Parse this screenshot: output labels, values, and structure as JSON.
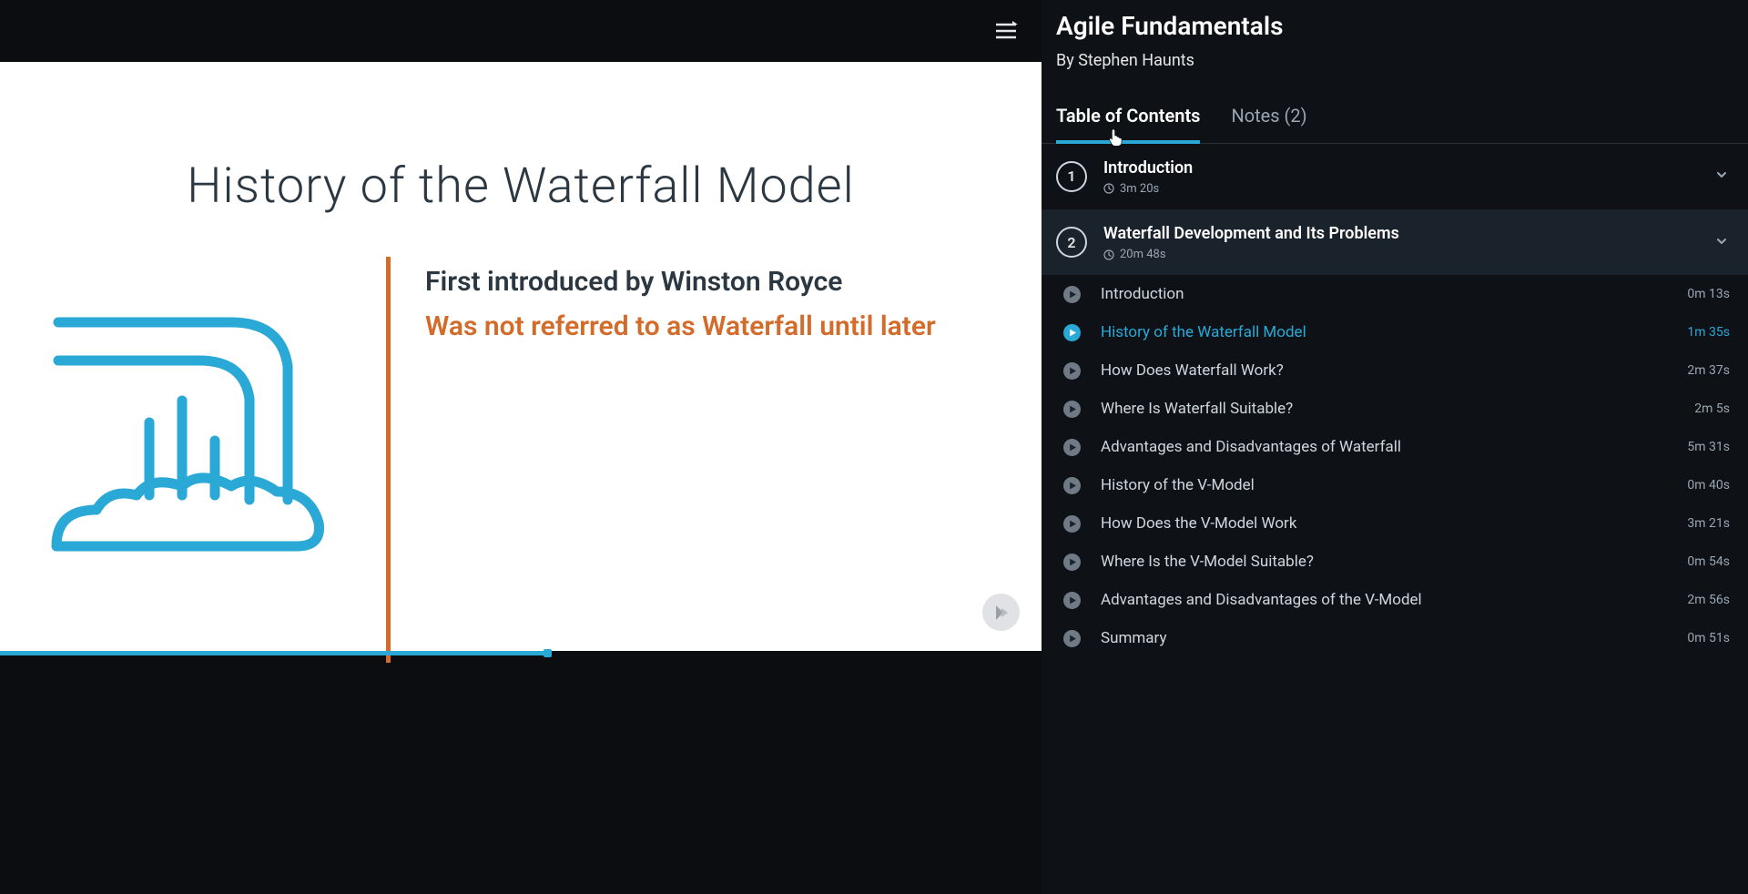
{
  "course": {
    "title": "Agile Fundamentals",
    "author": "By Stephen Haunts"
  },
  "tabs": {
    "toc_label": "Table of Contents",
    "notes_label": "Notes (2)",
    "active": "toc"
  },
  "slide": {
    "title": "History of the Waterfall Model",
    "line1": "First introduced by Winston Royce",
    "line2": "Was not referred to as Waterfall until later"
  },
  "progress": {
    "percent": 52.5
  },
  "modules": [
    {
      "num": "1",
      "title": "Introduction",
      "duration": "3m 20s",
      "expanded": false,
      "lessons": []
    },
    {
      "num": "2",
      "title": "Waterfall Development and Its Problems",
      "duration": "20m 48s",
      "expanded": true,
      "lessons": [
        {
          "title": "Introduction",
          "duration": "0m 13s",
          "current": false
        },
        {
          "title": "History of the Waterfall Model",
          "duration": "1m 35s",
          "current": true
        },
        {
          "title": "How Does Waterfall Work?",
          "duration": "2m 37s",
          "current": false
        },
        {
          "title": "Where Is Waterfall Suitable?",
          "duration": "2m 5s",
          "current": false
        },
        {
          "title": "Advantages and Disadvantages of Waterfall",
          "duration": "5m 31s",
          "current": false
        },
        {
          "title": "History of the V-Model",
          "duration": "0m 40s",
          "current": false
        },
        {
          "title": "How Does the V-Model Work",
          "duration": "3m 21s",
          "current": false
        },
        {
          "title": "Where Is the V-Model Suitable?",
          "duration": "0m 54s",
          "current": false
        },
        {
          "title": "Advantages and Disadvantages of the V-Model",
          "duration": "2m 56s",
          "current": false
        },
        {
          "title": "Summary",
          "duration": "0m 51s",
          "current": false
        }
      ]
    }
  ]
}
